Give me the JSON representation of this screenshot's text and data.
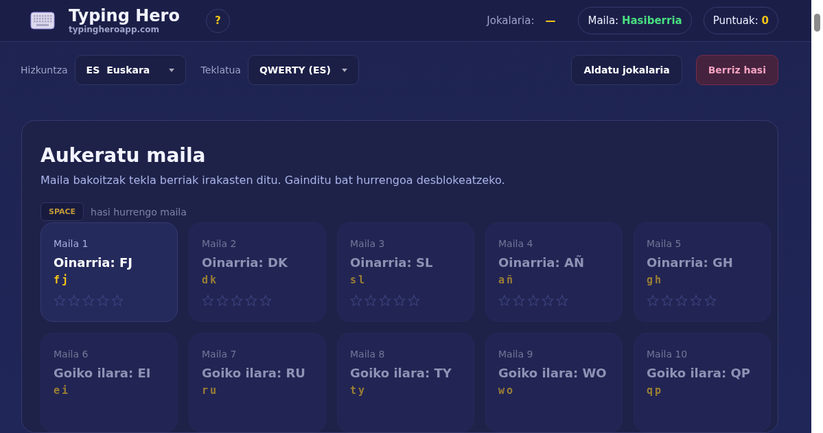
{
  "header": {
    "title": "Typing Hero",
    "subtitle": "typingheroapp.com",
    "help": "?",
    "player_label": "Jokalaria:",
    "player_value": "—",
    "level_badge": {
      "label": "Maila:",
      "value": "Hasiberria"
    },
    "score_badge": {
      "label": "Puntuak:",
      "value": "0"
    }
  },
  "toolbar": {
    "language": {
      "label": "Hizkuntza",
      "code": "ES",
      "value": "Euskara"
    },
    "keyboard": {
      "label": "Teklatua",
      "value": "QWERTY (ES)"
    },
    "buttons": [
      {
        "label": "Aldatu jokalaria",
        "kind": "neutral"
      },
      {
        "label": "Berriz hasi",
        "kind": "danger"
      }
    ]
  },
  "panel": {
    "title": "Aukeratu maila",
    "description": "Maila bakoitzak tekla berriak irakasten ditu. Gainditu bat hurrengoa desblokeatzeko.",
    "hint_key": "SPACE",
    "hint_text": "hasi hurrengo maila",
    "levels": [
      {
        "number": "Maila 1",
        "name": "Oinarria: FJ",
        "keys": "fj",
        "selected": true,
        "stars": 0
      },
      {
        "number": "Maila 2",
        "name": "Oinarria: DK",
        "keys": "dk",
        "selected": false,
        "stars": 0
      },
      {
        "number": "Maila 3",
        "name": "Oinarria: SL",
        "keys": "sl",
        "selected": false,
        "stars": 0
      },
      {
        "number": "Maila 4",
        "name": "Oinarria: AÑ",
        "keys": "añ",
        "selected": false,
        "stars": 0
      },
      {
        "number": "Maila 5",
        "name": "Oinarria: GH",
        "keys": "gh",
        "selected": false,
        "stars": 0
      },
      {
        "number": "Maila 6",
        "name": "Goiko ilara: EI",
        "keys": "ei",
        "selected": false
      },
      {
        "number": "Maila 7",
        "name": "Goiko ilara: RU",
        "keys": "ru",
        "selected": false
      },
      {
        "number": "Maila 8",
        "name": "Goiko ilara: TY",
        "keys": "ty",
        "selected": false
      },
      {
        "number": "Maila 9",
        "name": "Goiko ilara: WO",
        "keys": "wo",
        "selected": false
      },
      {
        "number": "Maila 10",
        "name": "Goiko ilara: QP",
        "keys": "qp",
        "selected": false
      }
    ]
  }
}
